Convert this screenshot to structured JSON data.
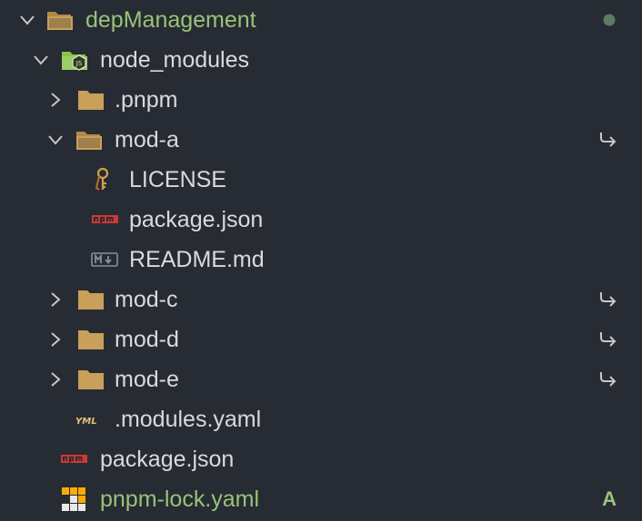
{
  "explorer": {
    "colors": {
      "background": "#272b33",
      "text": "#d7dae0",
      "git_added": "#98c379",
      "folder": "#c8a05a",
      "npm_red": "#cb3837",
      "yaml": "#e5c07b",
      "dot": "#5f7a62"
    },
    "root": {
      "label": "depManagement",
      "icon": "folder-open-icon",
      "expanded": true,
      "decoration": "modified-dot-icon"
    },
    "node_modules": {
      "label": "node_modules",
      "icon": "node-folder-icon",
      "expanded": true
    },
    "pnpm": {
      "label": ".pnpm",
      "icon": "folder-icon",
      "expanded": false
    },
    "mod_a": {
      "label": "mod-a",
      "icon": "folder-open-icon",
      "expanded": true,
      "decoration": "symlink-arrow-icon"
    },
    "license": {
      "label": "LICENSE",
      "icon": "license-key-icon"
    },
    "mod_a_package": {
      "label": "package.json",
      "icon": "npm-icon"
    },
    "readme": {
      "label": "README.md",
      "icon": "markdown-icon"
    },
    "mod_c": {
      "label": "mod-c",
      "icon": "folder-icon",
      "expanded": false,
      "decoration": "symlink-arrow-icon"
    },
    "mod_d": {
      "label": "mod-d",
      "icon": "folder-icon",
      "expanded": false,
      "decoration": "symlink-arrow-icon"
    },
    "mod_e": {
      "label": "mod-e",
      "icon": "folder-icon",
      "expanded": false,
      "decoration": "symlink-arrow-icon"
    },
    "modules_yaml": {
      "label": ".modules.yaml",
      "icon": "yaml-icon"
    },
    "package_json": {
      "label": "package.json",
      "icon": "npm-icon"
    },
    "pnpm_lock": {
      "label": "pnpm-lock.yaml",
      "icon": "pnpm-icon",
      "git_status": "A"
    }
  }
}
